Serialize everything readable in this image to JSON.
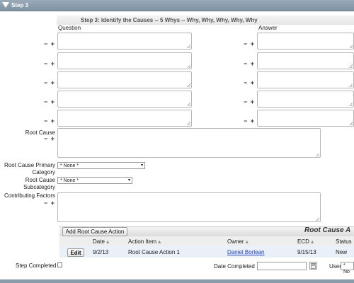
{
  "step_bar": {
    "title": "Step 3"
  },
  "section": {
    "heading": "Step 3: Identify the Causes -- 5 Whys -- Why, Why, Why, Why, Why"
  },
  "columns": {
    "question": "Question",
    "answer": "Answer"
  },
  "plus_minus": "− +",
  "fields": {
    "root_cause_label": "Root Cause",
    "primary_category_label": "Root Cause Primary Category",
    "primary_category_value": "* None *",
    "subcategory_label": "Root Cause Subcategory",
    "subcategory_value": "* None *",
    "contributing_label": "Contributing Factors"
  },
  "actions": {
    "add_button": "Add Root Cause Action",
    "panel_title": "Root Cause A",
    "headers": {
      "date": "Date",
      "action_item": "Action Item",
      "owner": "Owner",
      "ecd": "ECD",
      "status": "Status"
    },
    "sort_glyph": "▴",
    "rows": [
      {
        "edit": "Edit",
        "date": "9/2/13",
        "action_item": "Root Cause Action 1",
        "owner": "Daniel Borlean",
        "ecd": "9/15/13",
        "status": "New"
      }
    ]
  },
  "footer": {
    "step_completed_label": "Step Completed",
    "date_completed_label": "Date Completed",
    "user_label": "User",
    "user_value": "* No"
  },
  "icons": {
    "calendar": "calendar-icon",
    "collapse_arrow": "collapse-arrow-icon"
  }
}
